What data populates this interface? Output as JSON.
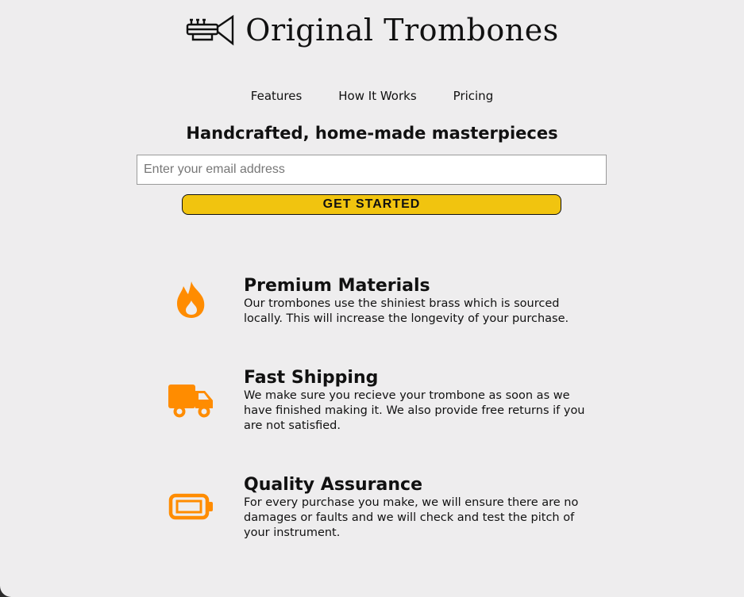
{
  "header": {
    "brand": "Original Trombones",
    "logo_icon": "trumpet-icon"
  },
  "nav": {
    "items": [
      {
        "label": "Features"
      },
      {
        "label": "How It Works"
      },
      {
        "label": "Pricing"
      }
    ]
  },
  "hero": {
    "title": "Handcrafted, home-made masterpieces",
    "email_placeholder": "Enter your email address",
    "email_value": "",
    "cta_label": "GET STARTED"
  },
  "features": [
    {
      "icon": "fire-icon",
      "title": "Premium Materials",
      "description": "Our trombones use the shiniest brass which is sourced locally. This will increase the longevity of your purchase."
    },
    {
      "icon": "truck-icon",
      "title": "Fast Shipping",
      "description": "We make sure you recieve your trombone as soon as we have finished making it. We also provide free returns if you are not satisfied."
    },
    {
      "icon": "battery-icon",
      "title": "Quality Assurance",
      "description": "For every purchase you make, we will ensure there are no damages or faults and we will check and test the pitch of your instrument."
    }
  ],
  "colors": {
    "accent": "#f1c40f",
    "icon": "#ff8c00",
    "background": "#eeedee"
  }
}
